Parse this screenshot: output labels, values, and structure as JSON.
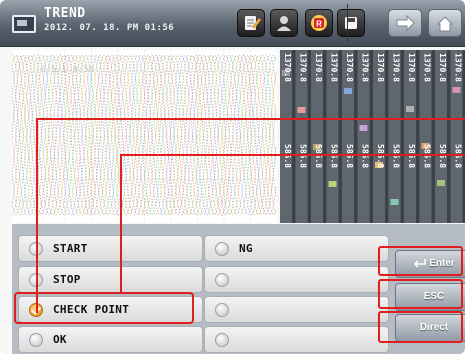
{
  "header": {
    "title": "TREND",
    "datetime": "2012. 07. 18. PM 01:56",
    "buttons": [
      {
        "name": "memo-icon",
        "style": "dark"
      },
      {
        "name": "user-icon",
        "style": "dark"
      },
      {
        "name": "record-icon",
        "style": "dark",
        "glyph": "R"
      },
      {
        "name": "save-icon",
        "style": "dark"
      },
      {
        "name": "arrow-right-icon",
        "style": "light"
      },
      {
        "name": "home-icon",
        "style": "light"
      }
    ]
  },
  "chart": {
    "watermark": "6/5/1 8:50",
    "top_values": [
      "1370.8",
      "1370.8",
      "1370.8",
      "1370.8",
      "1370.8",
      "1370.8",
      "1370.8",
      "1370.8",
      "1370.8",
      "1370.8",
      "1370.8",
      "1370.8"
    ],
    "bottom_values": [
      "585.8",
      "585.8",
      "585.8",
      "585.8",
      "585.8",
      "585.8",
      "585.8",
      "585.8",
      "585.8",
      "585.8",
      "585.8",
      "585.8"
    ],
    "series_colors": [
      "#9a9a9a",
      "#e59b9b",
      "#b7a36e",
      "#b4d47c",
      "#7fa8d8",
      "#c6a0d8",
      "#e4c07a",
      "#86c7b3",
      "#b0b0b0",
      "#e0a870",
      "#9fc27d",
      "#d493b5"
    ]
  },
  "events": {
    "items": [
      {
        "label": "START",
        "checked": false
      },
      {
        "label": "STOP",
        "checked": false
      },
      {
        "label": "CHECK POINT",
        "checked": true
      },
      {
        "label": "OK",
        "checked": false
      },
      {
        "label": "NG",
        "checked": false
      },
      {
        "label": "",
        "checked": false
      },
      {
        "label": "",
        "checked": false
      },
      {
        "label": "",
        "checked": false
      }
    ],
    "actions": [
      "Enter",
      "ESC",
      "Direct"
    ]
  }
}
